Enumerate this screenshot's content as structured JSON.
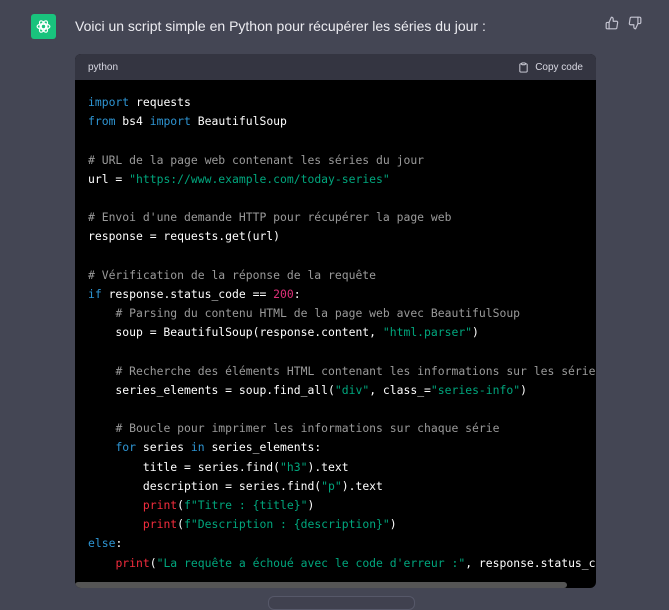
{
  "message": {
    "intro": "Voici un script simple en Python pour récupérer les séries du jour :"
  },
  "code_block": {
    "language": "python",
    "copy_label": "Copy code",
    "lines": [
      [
        {
          "t": "import",
          "c": "kw"
        },
        {
          "t": " requests"
        }
      ],
      [
        {
          "t": "from",
          "c": "kw"
        },
        {
          "t": " bs4 "
        },
        {
          "t": "import",
          "c": "kw"
        },
        {
          "t": " BeautifulSoup"
        }
      ],
      [],
      [
        {
          "t": "# URL de la page web contenant les séries du jour",
          "c": "cm"
        }
      ],
      [
        {
          "t": "url = "
        },
        {
          "t": "\"https://www.example.com/today-series\"",
          "c": "st"
        }
      ],
      [],
      [
        {
          "t": "# Envoi d'une demande HTTP pour récupérer la page web",
          "c": "cm"
        }
      ],
      [
        {
          "t": "response = requests.get(url)"
        }
      ],
      [],
      [
        {
          "t": "# Vérification de la réponse de la requête",
          "c": "cm"
        }
      ],
      [
        {
          "t": "if",
          "c": "kw"
        },
        {
          "t": " response.status_code == "
        },
        {
          "t": "200",
          "c": "nm"
        },
        {
          "t": ":"
        }
      ],
      [
        {
          "t": "    "
        },
        {
          "t": "# Parsing du contenu HTML de la page web avec BeautifulSoup",
          "c": "cm"
        }
      ],
      [
        {
          "t": "    soup = BeautifulSoup(response.content, "
        },
        {
          "t": "\"html.parser\"",
          "c": "st"
        },
        {
          "t": ")"
        }
      ],
      [],
      [
        {
          "t": "    "
        },
        {
          "t": "# Recherche des éléments HTML contenant les informations sur les séries",
          "c": "cm"
        }
      ],
      [
        {
          "t": "    series_elements = soup.find_all("
        },
        {
          "t": "\"div\"",
          "c": "st"
        },
        {
          "t": ", class_="
        },
        {
          "t": "\"series-info\"",
          "c": "st"
        },
        {
          "t": ")"
        }
      ],
      [],
      [
        {
          "t": "    "
        },
        {
          "t": "# Boucle pour imprimer les informations sur chaque série",
          "c": "cm"
        }
      ],
      [
        {
          "t": "    "
        },
        {
          "t": "for",
          "c": "kw"
        },
        {
          "t": " series "
        },
        {
          "t": "in",
          "c": "kw"
        },
        {
          "t": " series_elements:"
        }
      ],
      [
        {
          "t": "        title = series.find("
        },
        {
          "t": "\"h3\"",
          "c": "st"
        },
        {
          "t": ").text"
        }
      ],
      [
        {
          "t": "        description = series.find("
        },
        {
          "t": "\"p\"",
          "c": "st"
        },
        {
          "t": ").text"
        }
      ],
      [
        {
          "t": "        "
        },
        {
          "t": "print",
          "c": "fn"
        },
        {
          "t": "("
        },
        {
          "t": "f\"Titre : {title}\"",
          "c": "st"
        },
        {
          "t": ")"
        }
      ],
      [
        {
          "t": "        "
        },
        {
          "t": "print",
          "c": "fn"
        },
        {
          "t": "("
        },
        {
          "t": "f\"Description : {description}\"",
          "c": "st"
        },
        {
          "t": ")"
        }
      ],
      [
        {
          "t": "else",
          "c": "kw"
        },
        {
          "t": ":"
        }
      ],
      [
        {
          "t": "    "
        },
        {
          "t": "print",
          "c": "fn"
        },
        {
          "t": "("
        },
        {
          "t": "\"La requête a échoué avec le code d'erreur :\"",
          "c": "st"
        },
        {
          "t": ", response.status_code)"
        }
      ]
    ]
  },
  "colors": {
    "background": "#444654",
    "avatar": "#19c37d",
    "code_background": "#000000",
    "keyword": "#2e95d3",
    "comment": "#9a9a9a",
    "string": "#00a67d",
    "number": "#df3079",
    "builtin": "#f22c3d"
  },
  "icons": {
    "avatar": "openai-logo-icon",
    "thumbs_up": "thumbs-up-icon",
    "thumbs_down": "thumbs-down-icon",
    "copy": "clipboard-icon"
  }
}
